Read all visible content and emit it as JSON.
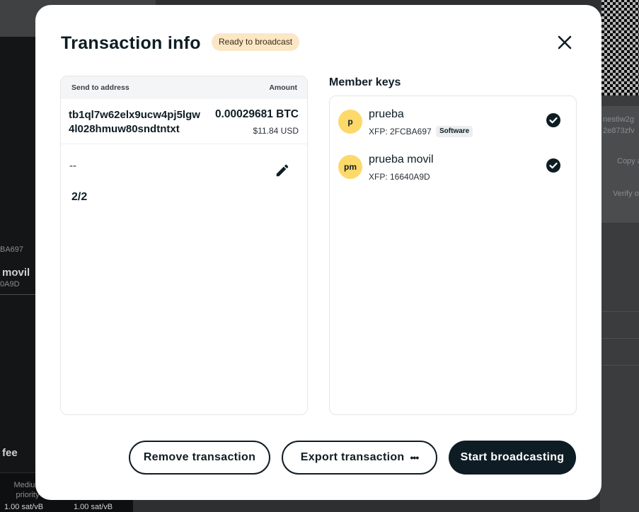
{
  "background": {
    "left_texts": [
      "BA697",
      "movil",
      "0A9D",
      "fee"
    ],
    "fee_items": [
      "Medium priority",
      "1.00 sat/vB",
      "1.00 sat/vB"
    ],
    "right_texts": [
      "nes6w2g",
      "2e873zfv",
      "Copy a",
      "Verify o"
    ]
  },
  "modal": {
    "title": "Transaction info",
    "status_badge": "Ready to broadcast",
    "close_icon": "close-icon"
  },
  "transaction": {
    "header_address": "Send to address",
    "header_amount": "Amount",
    "address": "tb1ql7w62elx9ucw4pj5lgw4l028hmuw80sndtntxt",
    "amount": "0.00029681 BTC",
    "amount_usd": "$11.84 USD",
    "memo": "--",
    "signatures": "2/2"
  },
  "member_keys": {
    "title": "Member keys",
    "keys": [
      {
        "initials": "p",
        "name": "prueba",
        "xfp": "XFP: 2FCBA697",
        "badge": "Software",
        "signed": true
      },
      {
        "initials": "pm",
        "name": "prueba movil",
        "xfp": "XFP: 16640A9D",
        "badge": "",
        "signed": true
      }
    ]
  },
  "actions": {
    "remove": "Remove transaction",
    "export": "Export transaction",
    "broadcast": "Start broadcasting"
  },
  "colors": {
    "primary": "#0e1d24",
    "badge_bg": "#fbe7c6",
    "avatar_bg": "#fcd96a"
  }
}
